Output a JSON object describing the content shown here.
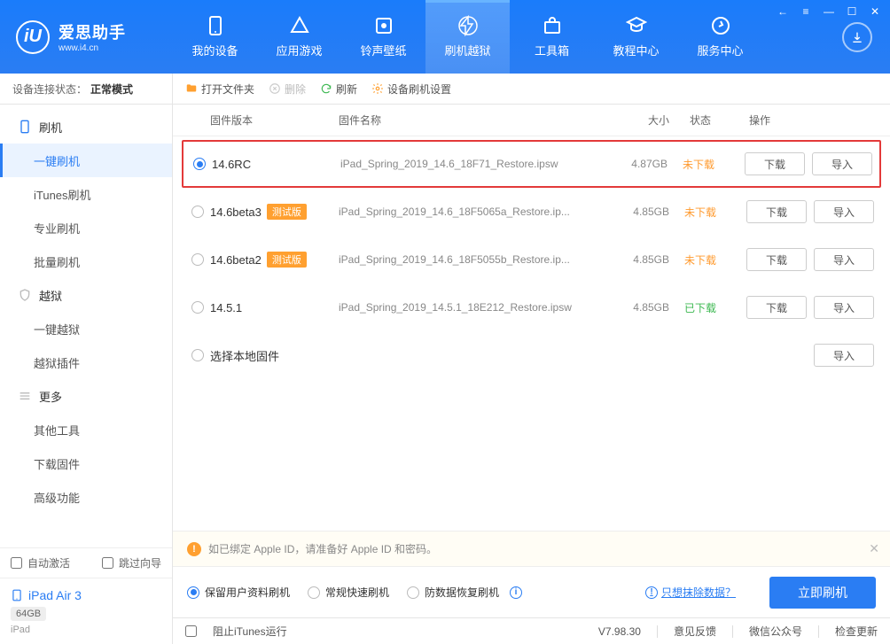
{
  "app": {
    "title": "爱思助手",
    "subtitle": "www.i4.cn"
  },
  "window_controls": [
    "back-icon",
    "list-icon",
    "minimize-icon",
    "maximize-icon",
    "close-icon"
  ],
  "nav": [
    {
      "id": "device",
      "label": "我的设备"
    },
    {
      "id": "apps",
      "label": "应用游戏"
    },
    {
      "id": "wallpaper",
      "label": "铃声壁纸"
    },
    {
      "id": "flash",
      "label": "刷机越狱",
      "active": true
    },
    {
      "id": "tools",
      "label": "工具箱"
    },
    {
      "id": "tutorial",
      "label": "教程中心"
    },
    {
      "id": "service",
      "label": "服务中心"
    }
  ],
  "sidebar": {
    "status_label": "设备连接状态：",
    "status_value": "正常模式",
    "groups": [
      {
        "head": "刷机",
        "icon": "phone-icon",
        "color": "#2a7df3",
        "items": [
          "一键刷机",
          "iTunes刷机",
          "专业刷机",
          "批量刷机"
        ],
        "activeIndex": 0
      },
      {
        "head": "越狱",
        "icon": "shield-icon",
        "color": "#bbb",
        "items": [
          "一键越狱",
          "越狱插件"
        ]
      },
      {
        "head": "更多",
        "icon": "menu-icon",
        "color": "#bbb",
        "items": [
          "其他工具",
          "下载固件",
          "高级功能"
        ]
      }
    ],
    "auto_activate": "自动激活",
    "skip_wizard": "跳过向导",
    "device": {
      "name": "iPad Air 3",
      "storage": "64GB",
      "type": "iPad"
    }
  },
  "toolbar": [
    {
      "id": "open",
      "label": "打开文件夹",
      "icon": "folder-icon",
      "color": "#ffa030"
    },
    {
      "id": "delete",
      "label": "删除",
      "icon": "x-icon",
      "disabled": true
    },
    {
      "id": "refresh",
      "label": "刷新",
      "icon": "refresh-icon",
      "color": "#3cb851"
    },
    {
      "id": "settings",
      "label": "设备刷机设置",
      "icon": "gear-icon",
      "color": "#ffa030"
    }
  ],
  "table": {
    "headers": {
      "version": "固件版本",
      "name": "固件名称",
      "size": "大小",
      "status": "状态",
      "op": "操作"
    }
  },
  "firmware": [
    {
      "version": "14.6RC",
      "name": "iPad_Spring_2019_14.6_18F71_Restore.ipsw",
      "size": "4.87GB",
      "status": "未下载",
      "status_type": "undl",
      "selected": true,
      "highlighted": true,
      "btns": [
        "下载",
        "导入"
      ]
    },
    {
      "version": "14.6beta3",
      "tag": "测试版",
      "name": "iPad_Spring_2019_14.6_18F5065a_Restore.ip...",
      "size": "4.85GB",
      "status": "未下载",
      "status_type": "undl",
      "btns": [
        "下载",
        "导入"
      ]
    },
    {
      "version": "14.6beta2",
      "tag": "测试版",
      "name": "iPad_Spring_2019_14.6_18F5055b_Restore.ip...",
      "size": "4.85GB",
      "status": "未下载",
      "status_type": "undl",
      "btns": [
        "下载",
        "导入"
      ]
    },
    {
      "version": "14.5.1",
      "name": "iPad_Spring_2019_14.5.1_18E212_Restore.ipsw",
      "size": "4.85GB",
      "status": "已下载",
      "status_type": "dl",
      "btns": [
        "下载",
        "导入"
      ]
    },
    {
      "version": "选择本地固件",
      "local": true,
      "btns": [
        "导入"
      ]
    }
  ],
  "tip": "如已绑定 Apple ID，请准备好 Apple ID 和密码。",
  "options": [
    {
      "label": "保留用户资料刷机",
      "selected": true
    },
    {
      "label": "常规快速刷机"
    },
    {
      "label": "防数据恢复刷机",
      "info": true
    }
  ],
  "erase_link": "只想抹除数据？",
  "flash_button": "立即刷机",
  "status": {
    "block_itunes": "阻止iTunes运行",
    "version": "V7.98.30",
    "feedback": "意见反馈",
    "wechat": "微信公众号",
    "update": "检查更新"
  }
}
